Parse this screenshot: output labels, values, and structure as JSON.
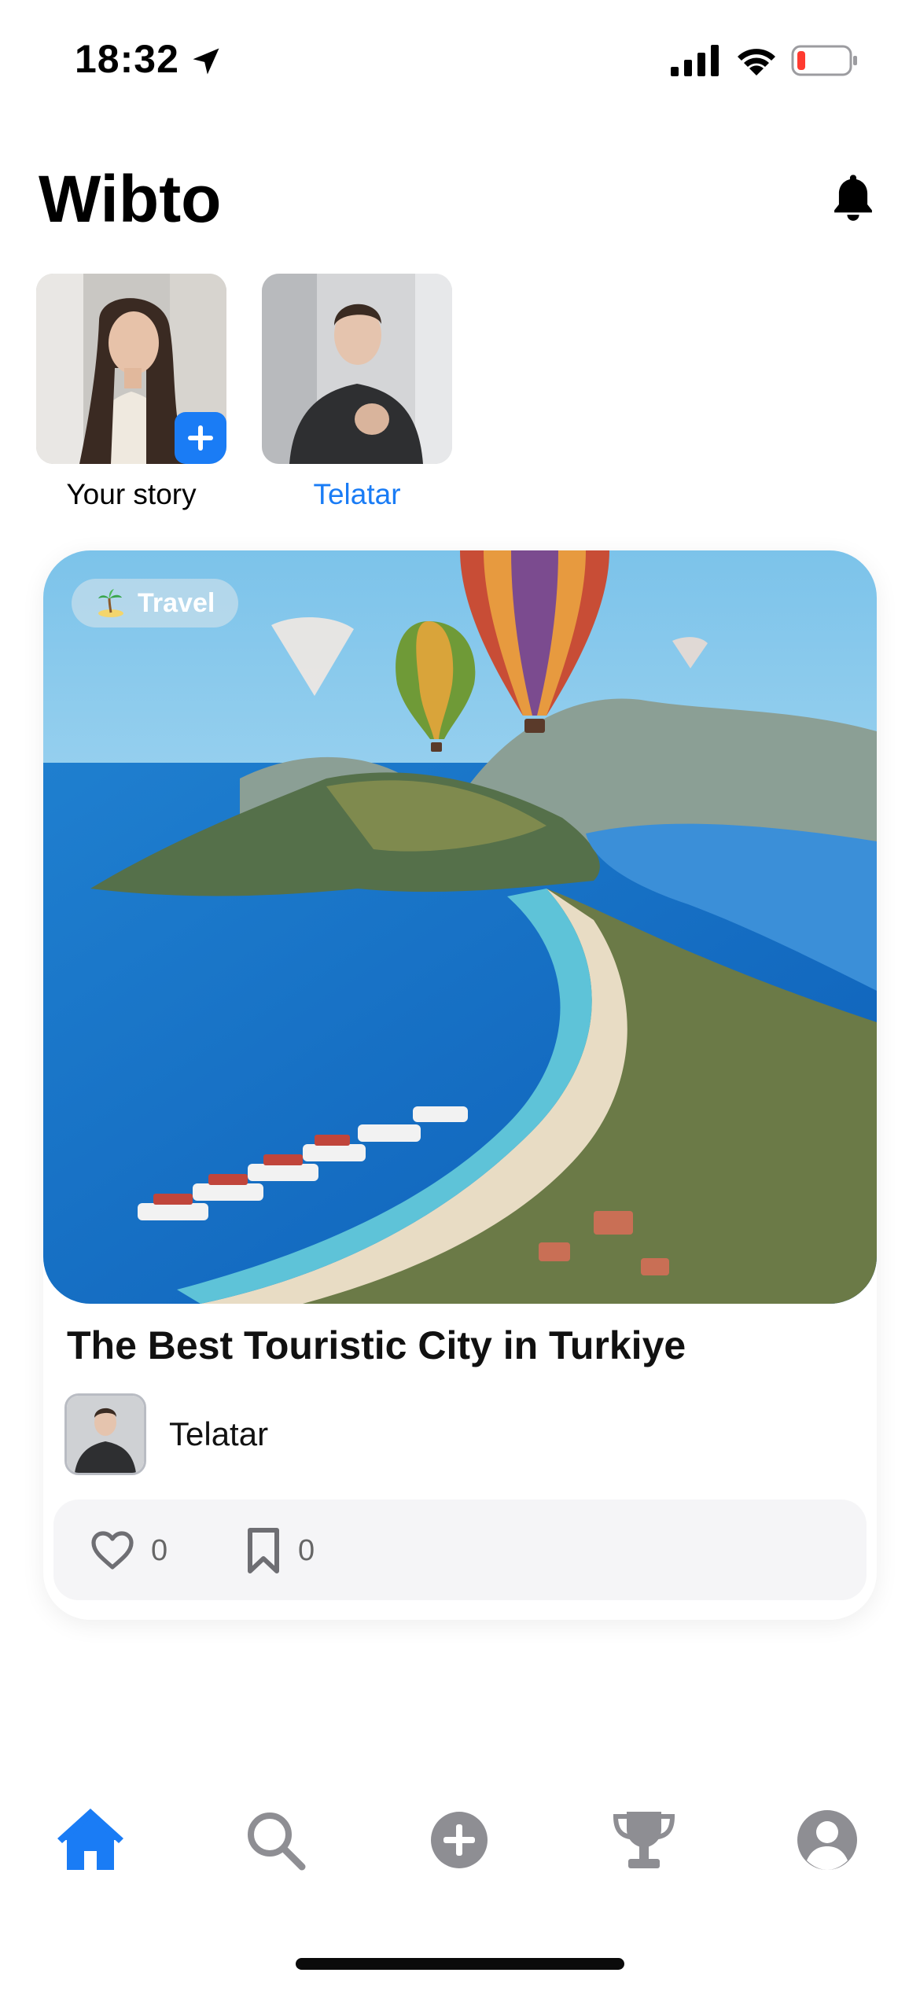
{
  "status_bar": {
    "time": "18:32",
    "icons": [
      "location-arrow-icon",
      "cellular-signal-icon",
      "wifi-icon",
      "battery-low-icon"
    ]
  },
  "header": {
    "title": "Wibto",
    "notification_icon": "bell-icon"
  },
  "stories": [
    {
      "label": "Your story",
      "label_color": "#111111",
      "has_add_badge": true
    },
    {
      "label": "Telatar",
      "label_color": "#1a7cf5",
      "has_add_badge": false
    }
  ],
  "post": {
    "category": {
      "emoji": "palm-island-emoji",
      "label": "Travel"
    },
    "title": "The Best Touristic City in Turkiye",
    "author": "Telatar",
    "likes": "0",
    "saves": "0"
  },
  "bottom_nav": {
    "items": [
      {
        "name": "home",
        "icon": "home-icon",
        "active": true
      },
      {
        "name": "search",
        "icon": "search-icon",
        "active": false
      },
      {
        "name": "create",
        "icon": "plus-circle-icon",
        "active": false
      },
      {
        "name": "leaderboard",
        "icon": "trophy-icon",
        "active": false
      },
      {
        "name": "profile",
        "icon": "user-circle-icon",
        "active": false
      }
    ]
  },
  "colors": {
    "accent": "#1a7cf5",
    "inactive_icon": "#8e8e93",
    "action_bar_bg": "#f5f5f7"
  }
}
